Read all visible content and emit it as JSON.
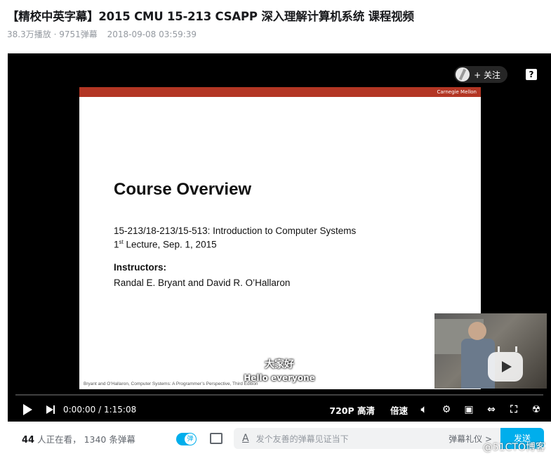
{
  "video": {
    "title": "【精校中英字幕】2015 CMU 15-213 CSAPP 深入理解计算机系统 课程视频",
    "views": "38.3万播放",
    "danmaku_count": "9751弹幕",
    "date": "2018-09-08 03:59:39"
  },
  "player": {
    "follow_label": "+ 关注",
    "help_icon": "?",
    "slide": {
      "header": "Carnegie Mellon",
      "title": "Course Overview",
      "course_line": "15-213/18-213/15-513: Introduction to Computer Systems",
      "lecture_prefix": "1",
      "lecture_sup": "st",
      "lecture_rest": " Lecture, Sep. 1, 2015",
      "instructors_label": "Instructors:",
      "instructors": "Randal E. Bryant and David R. O’Hallaron",
      "footer": "Bryant and O’Hallaron, Computer Systems: A Programmer’s Perspective, Third Edition"
    },
    "subtitle_zh": "大家好",
    "subtitle_en": "Hello everyone",
    "progress_fraction": 0.0,
    "controls": {
      "current_time": "0:00:00",
      "separator": "/",
      "duration": "1:15:08",
      "quality": "720P 高清",
      "speed": "倍速"
    }
  },
  "bottom_bar": {
    "viewers_count": "44",
    "viewers_text": " 人正在看，",
    "danmaku_text": "1340 条弹幕",
    "input_placeholder": "发个友善的弹幕见证当下",
    "etiquette": "弹幕礼仪 >",
    "send_label": "发送",
    "watermark": "@51CTO博客"
  },
  "colors": {
    "accent": "#00aeec",
    "slide_header": "#b33624",
    "player_bg": "#000000"
  }
}
